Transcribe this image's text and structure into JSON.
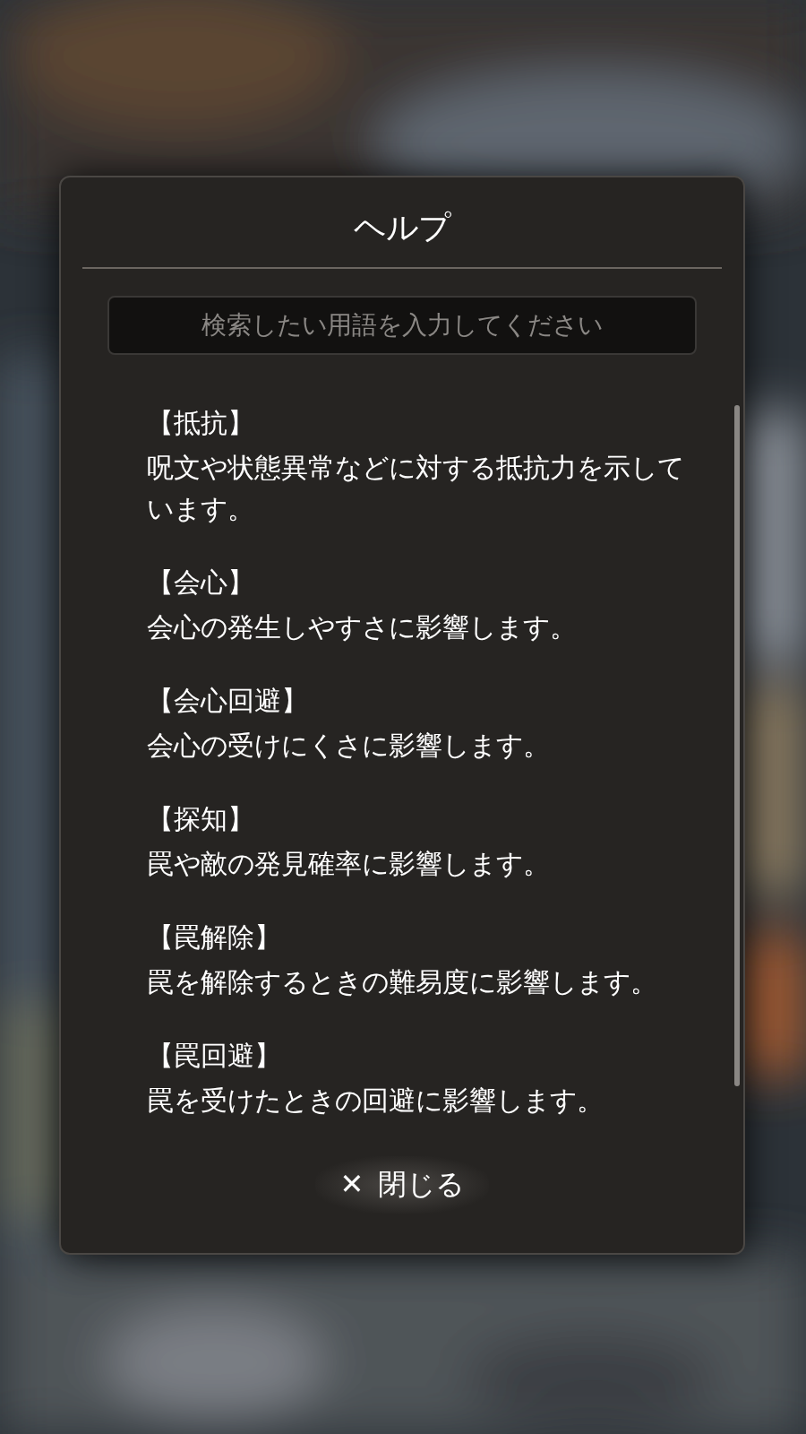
{
  "dialog": {
    "title": "ヘルプ",
    "search": {
      "placeholder": "検索したい用語を入力してください"
    },
    "entries": [
      {
        "term": "【抵抗】",
        "description": "呪文や状態異常などに対する抵抗力を示しています。"
      },
      {
        "term": "【会心】",
        "description": "会心の発生しやすさに影響します。"
      },
      {
        "term": "【会心回避】",
        "description": "会心の受けにくさに影響します。"
      },
      {
        "term": "【探知】",
        "description": "罠や敵の発見確率に影響します。"
      },
      {
        "term": "【罠解除】",
        "description": "罠を解除するときの難易度に影響します。"
      },
      {
        "term": "【罠回避】",
        "description": "罠を受けたときの回避に影響します。"
      }
    ],
    "close_button": {
      "icon": "✕",
      "label": "閉じる"
    }
  }
}
